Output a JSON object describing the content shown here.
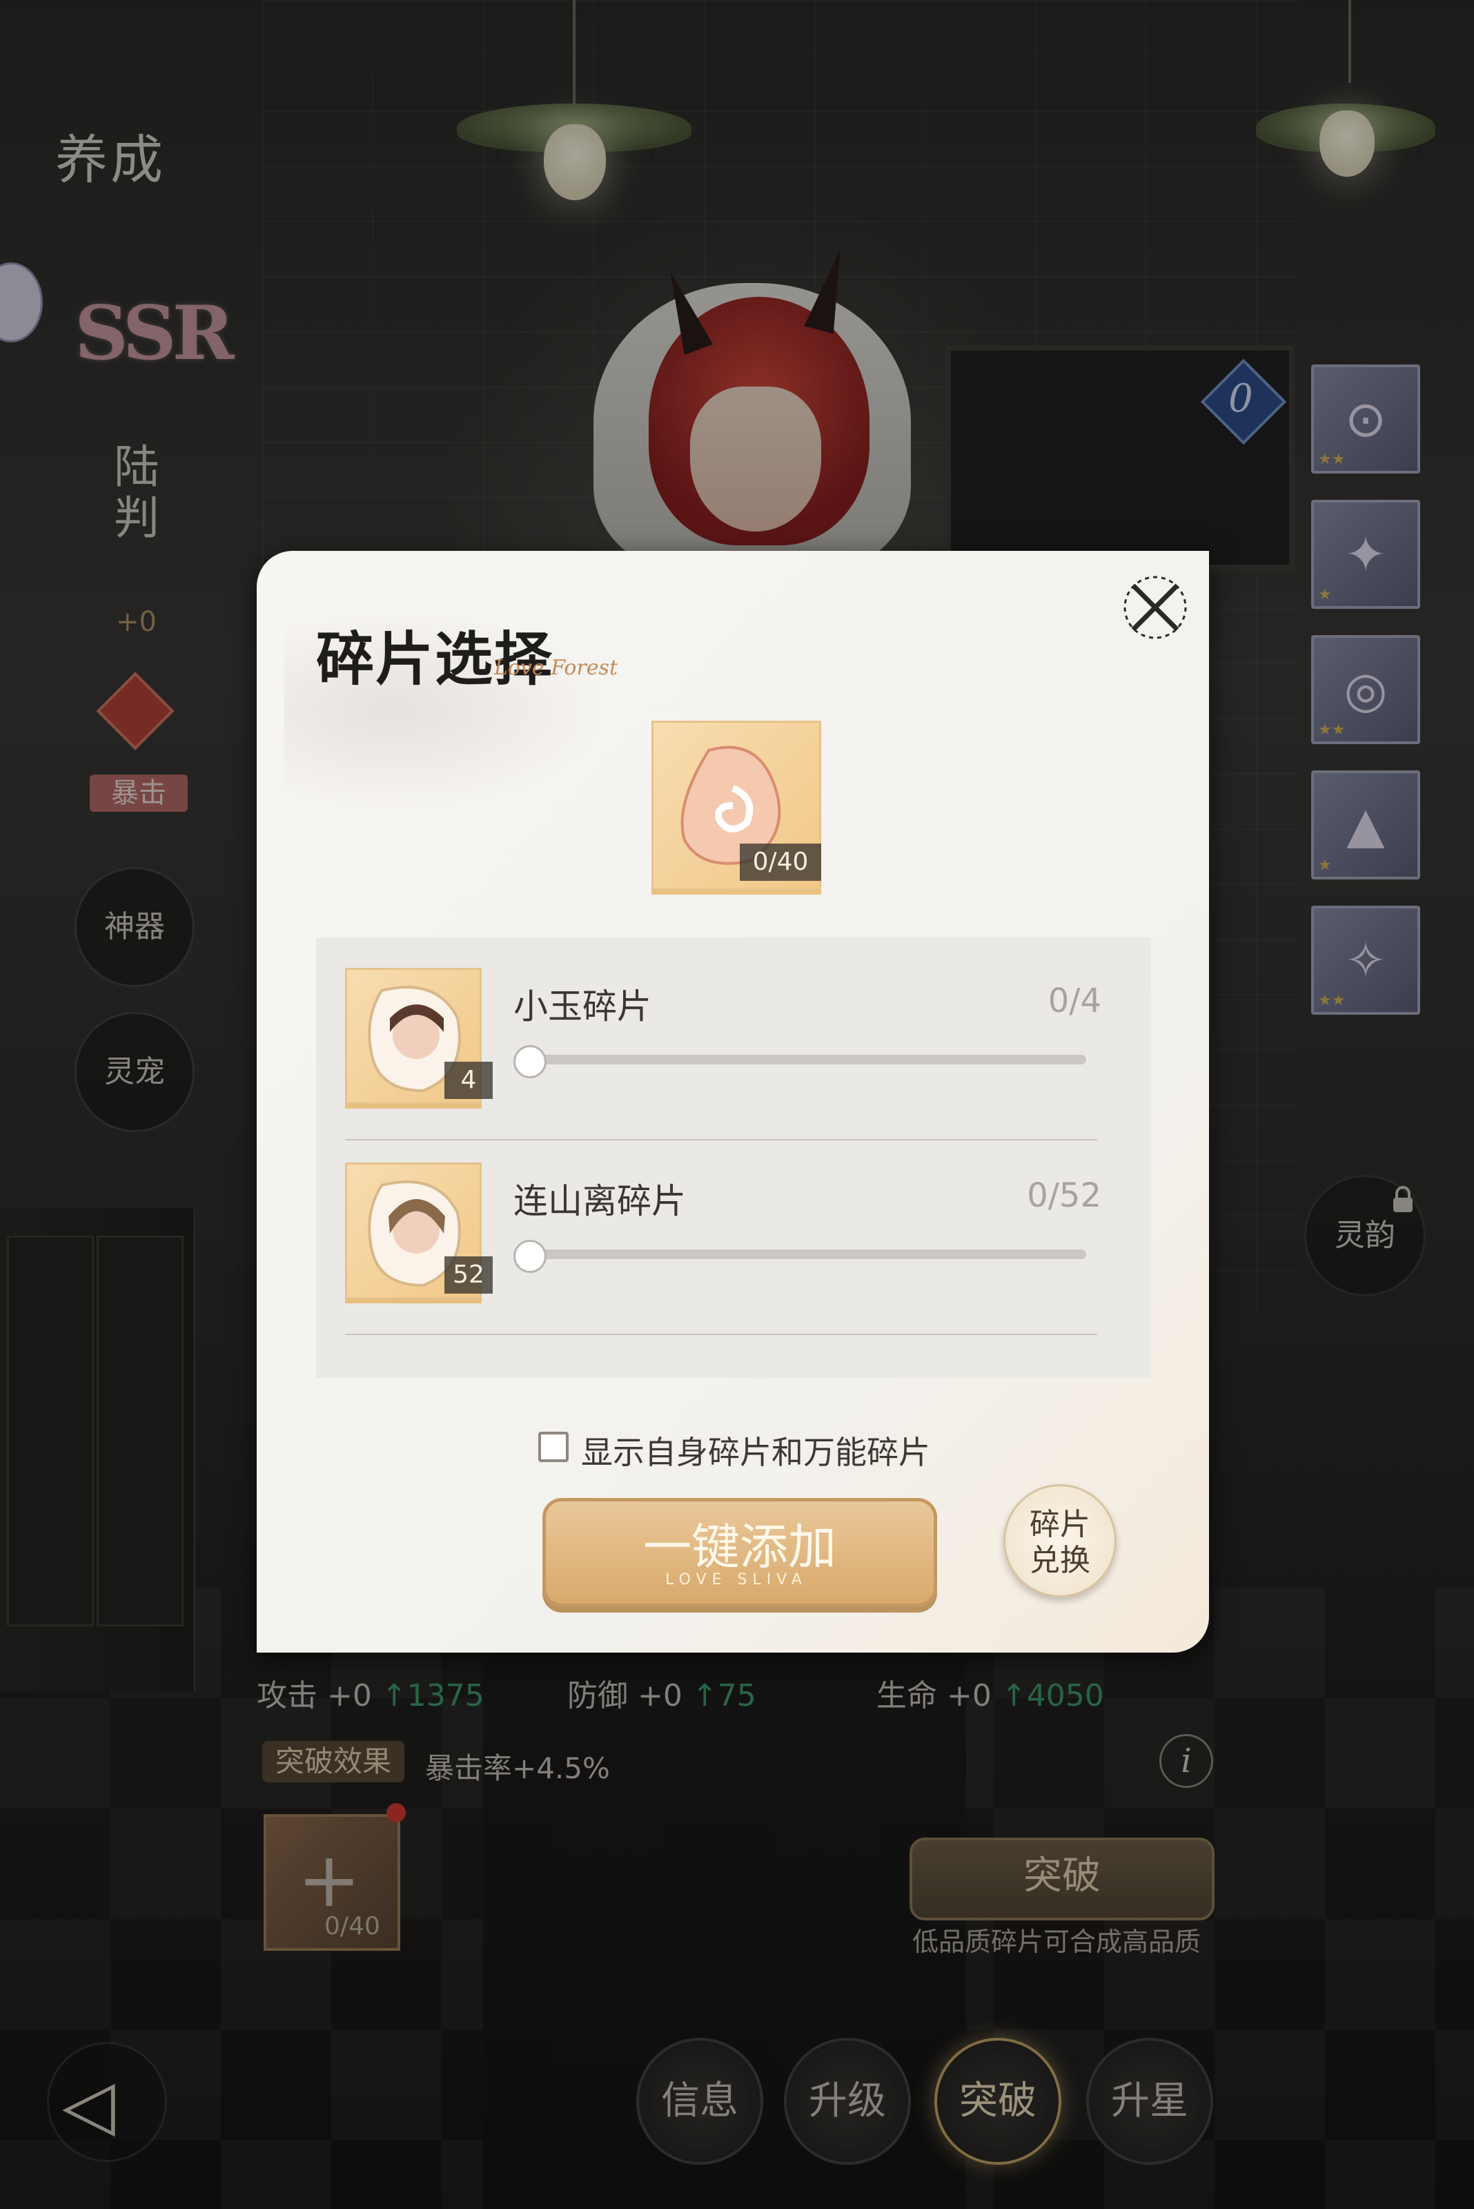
{
  "page": {
    "title": "养成",
    "rarity": "SSR",
    "character_name": "陆判",
    "level_bonus": "+0",
    "attribute_badge": "暴击"
  },
  "left_menu": {
    "artifact": "神器",
    "pet": "灵宠"
  },
  "right_panel": {
    "equip_count": "0",
    "equip_slots": [
      {
        "icon": "goggles-icon",
        "stars": "★★"
      },
      {
        "icon": "coat-icon",
        "stars": "★"
      },
      {
        "icon": "bracelet-icon",
        "stars": "★★"
      },
      {
        "icon": "boots-icon",
        "stars": "★"
      },
      {
        "icon": "compass-icon",
        "stars": "★★"
      }
    ],
    "linyun": "灵韵"
  },
  "modal": {
    "title": "碎片选择",
    "title_sub": "Love Forest",
    "main_fragment_count": "0/40",
    "fragments": [
      {
        "name": "小玉碎片",
        "owned": "4",
        "selected": "0/4",
        "selected_value": 0
      },
      {
        "name": "连山离碎片",
        "owned": "52",
        "selected": "0/52",
        "selected_value": 0
      }
    ],
    "show_own_checkbox": {
      "label": "显示自身碎片和万能碎片",
      "checked": false
    },
    "one_click_add": "一键添加",
    "one_click_sub": "LOVE SLIVA",
    "exchange_line1": "碎片",
    "exchange_line2": "兑换"
  },
  "stats": {
    "attack_label": "攻击 +0",
    "attack_up": "↑1375",
    "defense_label": "防御 +0",
    "defense_up": "↑75",
    "hp_label": "生命 +0",
    "hp_up": "↑4050"
  },
  "breakthrough": {
    "effect_tag": "突破效果",
    "effect_text": "暴击率+4.5%",
    "slot_count": "0/40",
    "button": "突破",
    "hint": "低品质碎片可合成高品质"
  },
  "tabs": [
    {
      "label": "信息",
      "active": false
    },
    {
      "label": "升级",
      "active": false
    },
    {
      "label": "突破",
      "active": true
    },
    {
      "label": "升星",
      "active": false
    }
  ],
  "colors": {
    "accent_gold": "#d8a96c",
    "stat_up_green": "#3f9d6b",
    "modal_bg": "#f3f1ed",
    "dim_background": "#1c1b1a"
  }
}
